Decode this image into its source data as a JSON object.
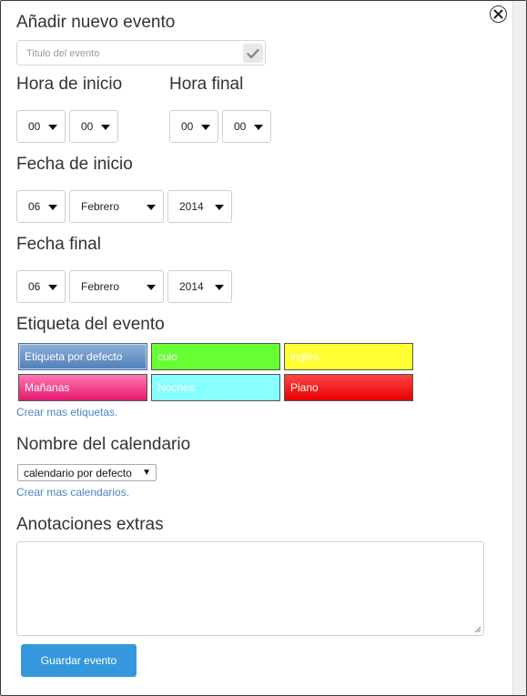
{
  "form": {
    "title": "Añadir nuevo evento",
    "event_title_placeholder": "Titulo del evento",
    "check_icon": "check-icon",
    "close_icon": "close-icon"
  },
  "start_time": {
    "label": "Hora de inicio",
    "hour": "00",
    "minute": "00"
  },
  "end_time": {
    "label": "Hora final",
    "hour": "00",
    "minute": "00"
  },
  "start_date": {
    "label": "Fecha de inicio",
    "day": "06",
    "month": "Febrero",
    "year": "2014"
  },
  "end_date": {
    "label": "Fecha final",
    "day": "06",
    "month": "Febrero",
    "year": "2014"
  },
  "tags": {
    "label": "Etiqueta del evento",
    "items": [
      {
        "label": "Etiqueta por defecto",
        "color": "#5b86bf"
      },
      {
        "label": "culo",
        "color": "#66ff33"
      },
      {
        "label": "ingles",
        "color": "#ffff33"
      },
      {
        "label": "Mañanas",
        "color": "#ee2a7f"
      },
      {
        "label": "Noches",
        "color": "#88ffff"
      },
      {
        "label": "Piano",
        "color": "#f01010"
      }
    ],
    "create_link": "Crear mas etiquetas."
  },
  "calendar": {
    "label": "Nombre del calendario",
    "selected": "calendario por defecto",
    "create_link": "Crear mas calendarios."
  },
  "notes": {
    "label": "Anotaciones extras",
    "value": ""
  },
  "actions": {
    "save_label": "Guardar evento"
  },
  "colors": {
    "primary_button": "#3598dc",
    "link": "#4b86c2"
  }
}
